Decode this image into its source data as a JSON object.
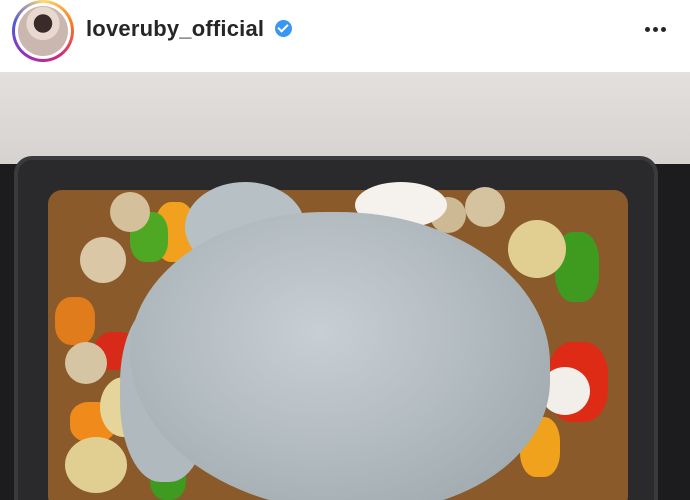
{
  "post_header": {
    "username": "loveruby_official",
    "verified": true,
    "avatar_icon": "profile-avatar",
    "more_icon": "more-options-icon"
  },
  "photo": {
    "subject_icon": "post-photo",
    "colors": {
      "accent_verified": "#3897f0",
      "text": "#262626"
    }
  }
}
